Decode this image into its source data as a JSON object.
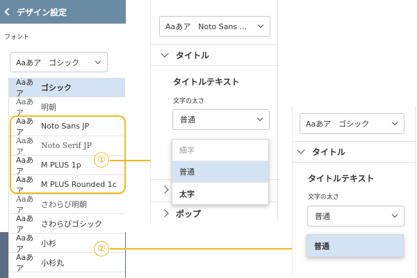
{
  "left": {
    "header_title": "デザイン設定",
    "font_label": "フォント",
    "selected_font": "Aaあア　ゴシック",
    "font_list": [
      {
        "sample": "Aaあア",
        "name": "ゴシック",
        "selected": true,
        "style": "sans-bold"
      },
      {
        "sample": "Aaあア",
        "name": "明朝",
        "style": "serif"
      },
      {
        "sample": "Aaあア",
        "name": "Noto Sans JP",
        "style": "sans"
      },
      {
        "sample": "Aaあア",
        "name": "Noto Serif JP",
        "style": "serif"
      },
      {
        "sample": "Aaあア",
        "name": "M PLUS 1p",
        "style": "sans"
      },
      {
        "sample": "Aaあア",
        "name": "M PLUS Rounded 1c",
        "style": "sans"
      },
      {
        "sample": "Aaあア",
        "name": "さわらび明朝",
        "style": "serif"
      },
      {
        "sample": "Aaあア",
        "name": "さわらびゴシック",
        "style": "sans"
      },
      {
        "sample": "Aaあア",
        "name": "小杉",
        "style": "sans"
      },
      {
        "sample": "Aaあア",
        "name": "小杉丸",
        "style": "sans"
      }
    ]
  },
  "annotations": {
    "step1": "①",
    "step2": "②",
    "accent_color": "#f2b71b"
  },
  "middle": {
    "font_select_value": "Aaあア　Noto Sans ...",
    "section_title": "タイトル",
    "sub_title": "タイトルテキスト",
    "weight_label": "文字の太さ",
    "weight_value": "普通",
    "dropdown_options": [
      "細字",
      "普通",
      "太字"
    ],
    "dropdown_selected": "普通",
    "section_popup_partial": "ポップ"
  },
  "right": {
    "font_select_value": "Aaあア　ゴシック",
    "section_title": "タイトル",
    "sub_title": "タイトルテキスト",
    "weight_label": "文字の太さ",
    "weight_value": "普通",
    "dropdown_options": [
      "普通"
    ],
    "dropdown_selected": "普通"
  },
  "colors": {
    "sidebar_bg": "#5b6e83",
    "header_bg": "#6a8ba4",
    "selected_row": "#d3e3f3"
  }
}
